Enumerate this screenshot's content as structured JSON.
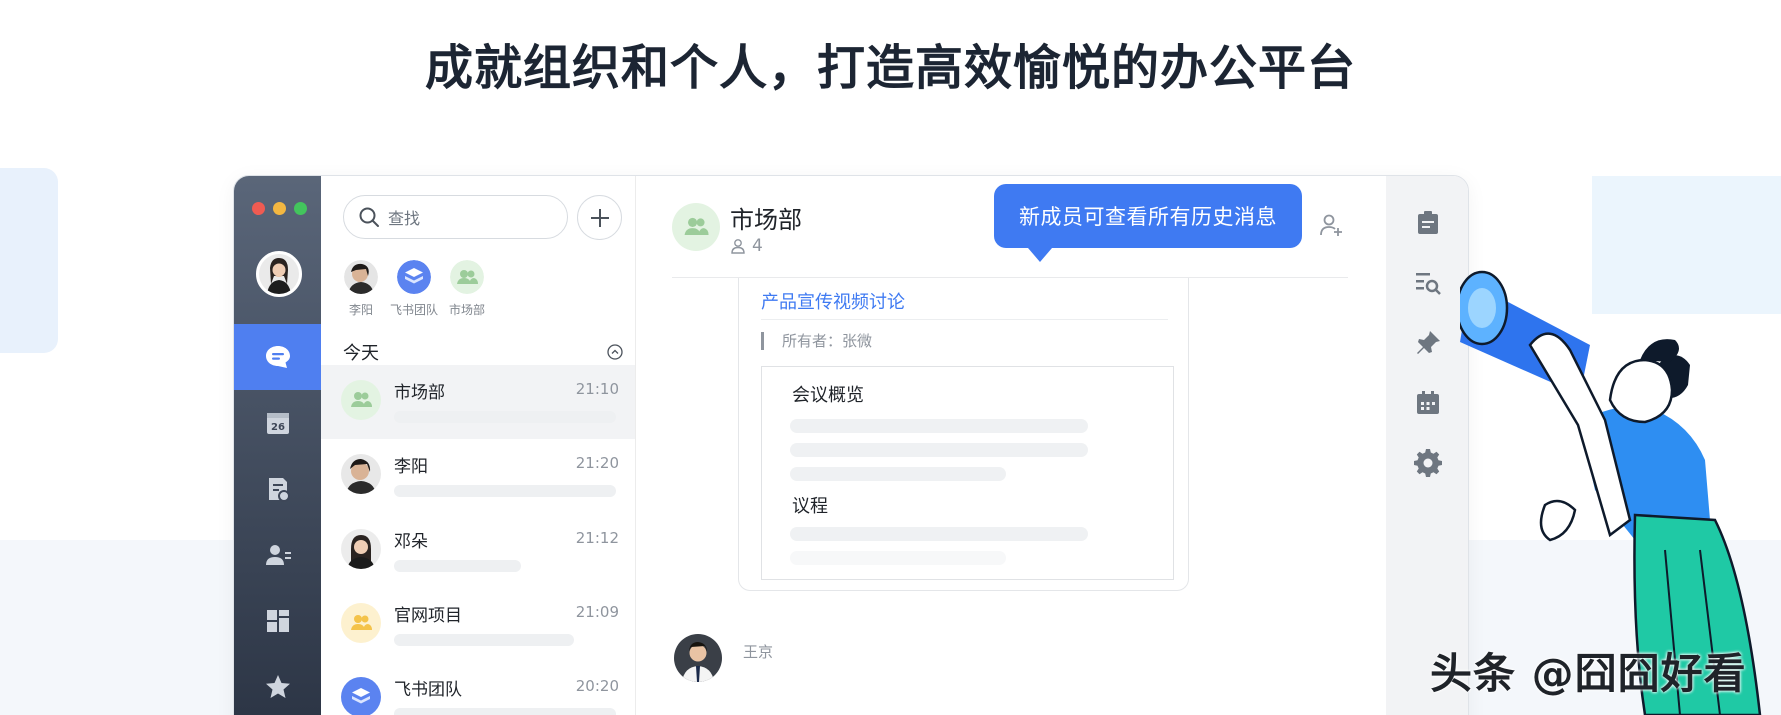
{
  "headline": "成就组织和个人，打造高效愉悦的办公平台",
  "nav_rail": {
    "items": [
      {
        "name": "messages",
        "active": true
      },
      {
        "name": "calendar",
        "date_label": "26"
      },
      {
        "name": "docs"
      },
      {
        "name": "contacts"
      },
      {
        "name": "workplace"
      },
      {
        "name": "favorites"
      }
    ]
  },
  "chat_list": {
    "search_placeholder": "查找",
    "recent": [
      {
        "name": "李阳"
      },
      {
        "name": "飞书团队"
      },
      {
        "name": "市场部"
      }
    ],
    "section_label": "今天",
    "chats": [
      {
        "name": "市场部",
        "time": "21:10",
        "selected": true
      },
      {
        "name": "李阳",
        "time": "21:20"
      },
      {
        "name": "邓朵",
        "time": "21:12"
      },
      {
        "name": "官网项目",
        "time": "21:09"
      },
      {
        "name": "飞书团队",
        "time": "20:20"
      }
    ]
  },
  "conversation": {
    "title": "市场部",
    "member_count": "4",
    "tooltip": "新成员可查看所有历史消息",
    "doc_card": {
      "title": "产品宣传视频讨论",
      "owner": "所有者：张微",
      "section1": "会议概览",
      "section2": "议程"
    },
    "next_sender": "王京"
  },
  "colors": {
    "accent": "#3f7af2",
    "rail_active": "#4f7ff0"
  },
  "watermark": "头条 @囧囧好看"
}
